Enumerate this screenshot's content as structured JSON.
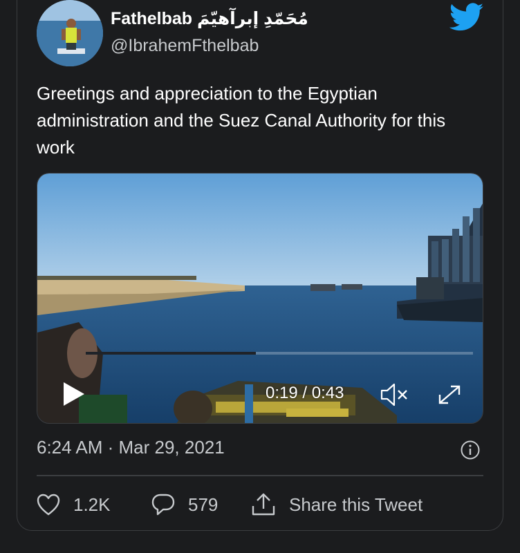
{
  "tweet": {
    "display_name": "Fathelbab مُحَمّدِ إبرآهيّمَ",
    "handle": "@IbrahemFthelbab",
    "text": "Greetings and appreciation to the Egyptian administration and the Suez Canal Authority for this work",
    "timestamp": "6:24 AM · Mar 29, 2021"
  },
  "video": {
    "time": "0:19 / 0:43",
    "progress": 0.44
  },
  "actions": {
    "likes": "1.2K",
    "replies": "579",
    "share_label": "Share this Tweet"
  },
  "icons": {
    "brand": "twitter-bird-icon",
    "like": "heart-icon",
    "reply": "speech-bubble-icon",
    "share": "share-arrow-icon",
    "info": "info-icon",
    "play": "play-icon",
    "mute": "mute-icon",
    "fullscreen": "expand-icon"
  },
  "colors": {
    "background": "#1b1c1e",
    "text_primary": "#ffffff",
    "text_secondary": "#c7cacd",
    "brand": "#1da1f2",
    "border": "#3c3e41"
  }
}
